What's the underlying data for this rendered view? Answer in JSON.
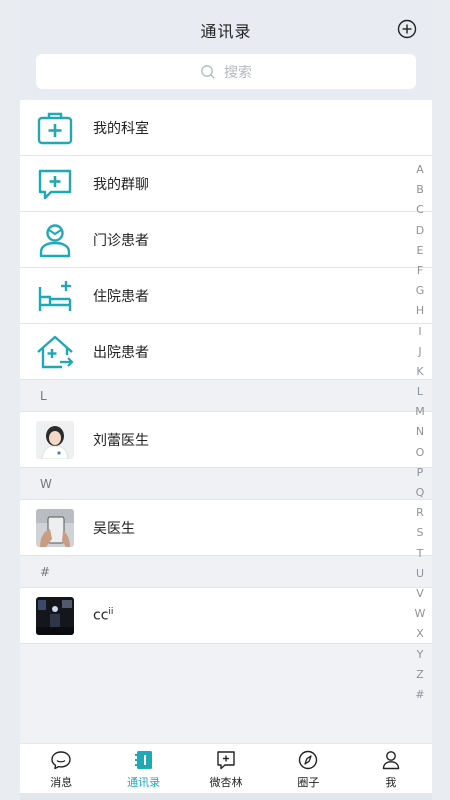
{
  "header": {
    "title": "通讯录",
    "add_icon": "plus-circle-icon"
  },
  "search": {
    "placeholder": "搜索",
    "icon": "search-icon"
  },
  "categories": [
    {
      "label": "我的科室",
      "icon": "medical-kit-icon"
    },
    {
      "label": "我的群聊",
      "icon": "chat-plus-icon"
    },
    {
      "label": "门诊患者",
      "icon": "patient-icon"
    },
    {
      "label": "住院患者",
      "icon": "hospital-bed-icon"
    },
    {
      "label": "出院患者",
      "icon": "discharge-house-icon"
    }
  ],
  "sections": [
    {
      "letter": "L",
      "contacts": [
        {
          "name": "刘蕾医生",
          "avatar": "doctor-avatar"
        }
      ]
    },
    {
      "letter": "W",
      "contacts": [
        {
          "name": "吴医生",
          "avatar": "phone-hand-avatar"
        }
      ]
    },
    {
      "letter": "#",
      "contacts": [
        {
          "name": "cc",
          "sup": "ii",
          "avatar": "dark-photo-avatar"
        }
      ]
    }
  ],
  "index_letters": [
    "A",
    "B",
    "C",
    "D",
    "E",
    "F",
    "G",
    "H",
    "I",
    "J",
    "K",
    "L",
    "M",
    "N",
    "O",
    "P",
    "Q",
    "R",
    "S",
    "T",
    "U",
    "V",
    "W",
    "X",
    "Y",
    "Z",
    "#"
  ],
  "tabs": [
    {
      "label": "消息",
      "icon": "message-bubble-icon",
      "active": false
    },
    {
      "label": "通讯录",
      "icon": "address-book-icon",
      "active": true
    },
    {
      "label": "微杏林",
      "icon": "plus-square-icon",
      "active": false
    },
    {
      "label": "圈子",
      "icon": "compass-icon",
      "active": false
    },
    {
      "label": "我",
      "icon": "person-icon",
      "active": false
    }
  ],
  "colors": {
    "accent": "#1fa9b6",
    "text": "#222222",
    "muted": "#b4b8bf"
  }
}
